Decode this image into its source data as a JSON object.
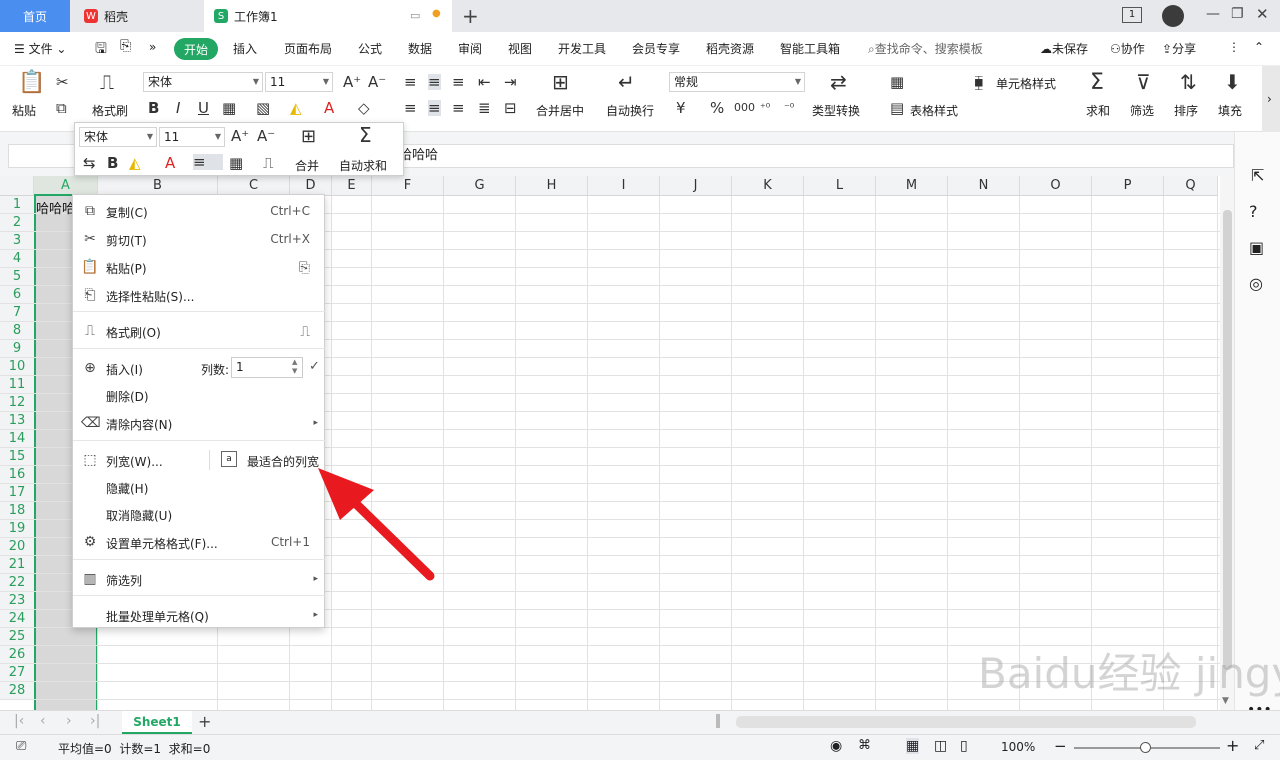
{
  "tabs": {
    "home": "首页",
    "daoke": "稻壳",
    "workbook": "工作簿1",
    "new_tab": "+"
  },
  "menu": {
    "file": "文件",
    "items": [
      "插入",
      "页面布局",
      "公式",
      "数据",
      "审阅",
      "视图",
      "开发工具",
      "会员专享",
      "稻壳资源",
      "智能工具箱"
    ],
    "start": "开始",
    "search_placeholder": "查找命令、搜索模板",
    "unsaved": "未保存",
    "collab": "协作",
    "share": "分享"
  },
  "ribbon": {
    "paste": "粘贴",
    "format_painter": "格式刷",
    "font": "宋体",
    "size": "11",
    "merge_center": "合并居中",
    "wrap": "自动换行",
    "number_format": "常规",
    "type_convert": "类型转换",
    "cell_style": "单元格样式",
    "table_style": "表格样式",
    "sum": "求和",
    "filter": "筛选",
    "sort": "排序",
    "fill": "填充",
    "currency": "¥",
    "percent": "%",
    "thousands": "000"
  },
  "formula": {
    "content": "哈哈哈",
    "name_box": ""
  },
  "mini": {
    "font": "宋体",
    "size": "11",
    "merge": "合并",
    "autosum": "自动求和"
  },
  "grid": {
    "columns": [
      "A",
      "B",
      "C",
      "D",
      "E",
      "F",
      "G",
      "H",
      "I",
      "J",
      "K",
      "L",
      "M",
      "N",
      "O",
      "P",
      "Q"
    ],
    "rows": [
      "1",
      "2",
      "3",
      "4",
      "5",
      "6",
      "7",
      "8",
      "9",
      "10",
      "11",
      "12",
      "13",
      "14",
      "15",
      "16",
      "17",
      "18",
      "19",
      "20",
      "21",
      "22",
      "23",
      "24",
      "25",
      "26",
      "27",
      "28"
    ],
    "a1": "哈哈哈"
  },
  "context_menu": {
    "copy": {
      "label": "复制(C)",
      "shortcut": "Ctrl+C"
    },
    "cut": {
      "label": "剪切(T)",
      "shortcut": "Ctrl+X"
    },
    "paste": {
      "label": "粘贴(P)"
    },
    "paste_special": {
      "label": "选择性粘贴(S)..."
    },
    "format_painter": {
      "label": "格式刷(O)"
    },
    "insert": {
      "label": "插入(I)",
      "count_label": "列数:",
      "count_value": "1"
    },
    "delete": {
      "label": "删除(D)"
    },
    "clear": {
      "label": "清除内容(N)"
    },
    "col_width": {
      "label": "列宽(W)...",
      "best_fit": "最适合的列宽"
    },
    "hide": {
      "label": "隐藏(H)"
    },
    "unhide": {
      "label": "取消隐藏(U)"
    },
    "format_cells": {
      "label": "设置单元格格式(F)...",
      "shortcut": "Ctrl+1"
    },
    "filter_col": {
      "label": "筛选列"
    },
    "batch": {
      "label": "批量处理单元格(Q)"
    }
  },
  "sheet": {
    "name": "Sheet1"
  },
  "status": {
    "summary": "平均值=0  计数=1  求和=0",
    "zoom": "100%"
  },
  "watermark": "Baidu经验 jingyan.baidu.com",
  "colors": {
    "accent": "#23a765",
    "tab_blue": "#4a8ef0",
    "arrow_red": "#e8191f"
  }
}
